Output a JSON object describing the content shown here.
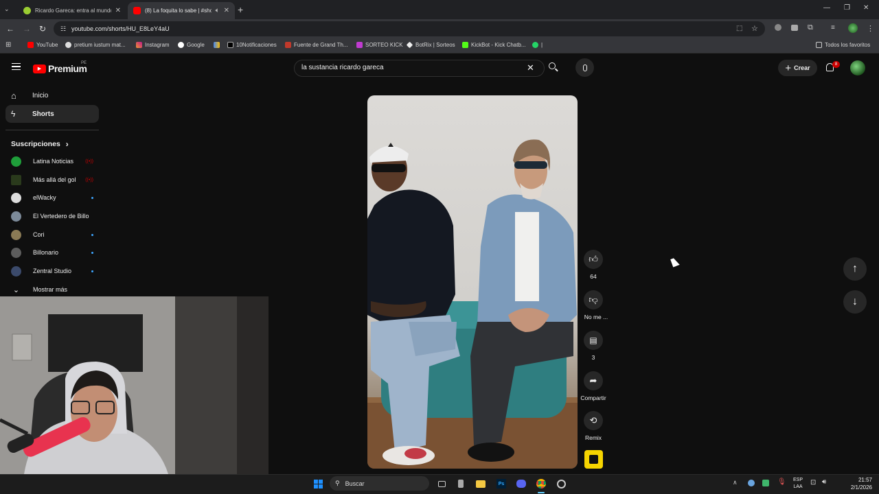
{
  "browser": {
    "tabs": [
      {
        "title": "Ricardo Gareca: entra al mundo",
        "active": false
      },
      {
        "title": "(8) La foquita lo sabe | #sho",
        "active": true
      }
    ],
    "url": "youtube.com/shorts/HU_E8LeY4aU",
    "bookmarks": [
      "YouTube",
      "pretium iustum mat...",
      "Instagram",
      "Google",
      "",
      "10Notificaciones",
      "Fuente de Grand Th...",
      "SORTEO KICK",
      "BotRix | Sorteos",
      "KickBot - Kick Chatb...",
      "|"
    ],
    "all_bookmarks": "Todos los favoritos"
  },
  "youtube": {
    "logo": "Premium",
    "region": "PE",
    "search_query": "la sustancia ricardo gareca",
    "create_label": "Crear",
    "notifications": "8",
    "nav": [
      {
        "label": "Inicio",
        "icon": "home-icon"
      },
      {
        "label": "Shorts",
        "icon": "shorts-icon"
      }
    ],
    "subs_title": "Suscripciones",
    "subscriptions": [
      {
        "name": "Latina Noticias",
        "indicator": "live"
      },
      {
        "name": "Más allá del gol",
        "indicator": "live"
      },
      {
        "name": "elWacky",
        "indicator": "dot"
      },
      {
        "name": "El Vertedero de Billo",
        "indicator": ""
      },
      {
        "name": "Cori",
        "indicator": "dot"
      },
      {
        "name": "Billonario",
        "indicator": "dot"
      },
      {
        "name": "Zentral Studio",
        "indicator": "dot"
      }
    ],
    "show_more": "Mostrar más",
    "actions": {
      "likes": "64",
      "dislike": "No me ...",
      "comments": "3",
      "share": "Compartir",
      "remix": "Remix"
    }
  },
  "taskbar": {
    "search": "Buscar",
    "lang": "ESP",
    "lang2": "LAA",
    "time": "21:57",
    "date": "2/1/2026"
  },
  "colors": {
    "youtube_red": "#ff0000",
    "link_blue": "#3ea6ff"
  }
}
